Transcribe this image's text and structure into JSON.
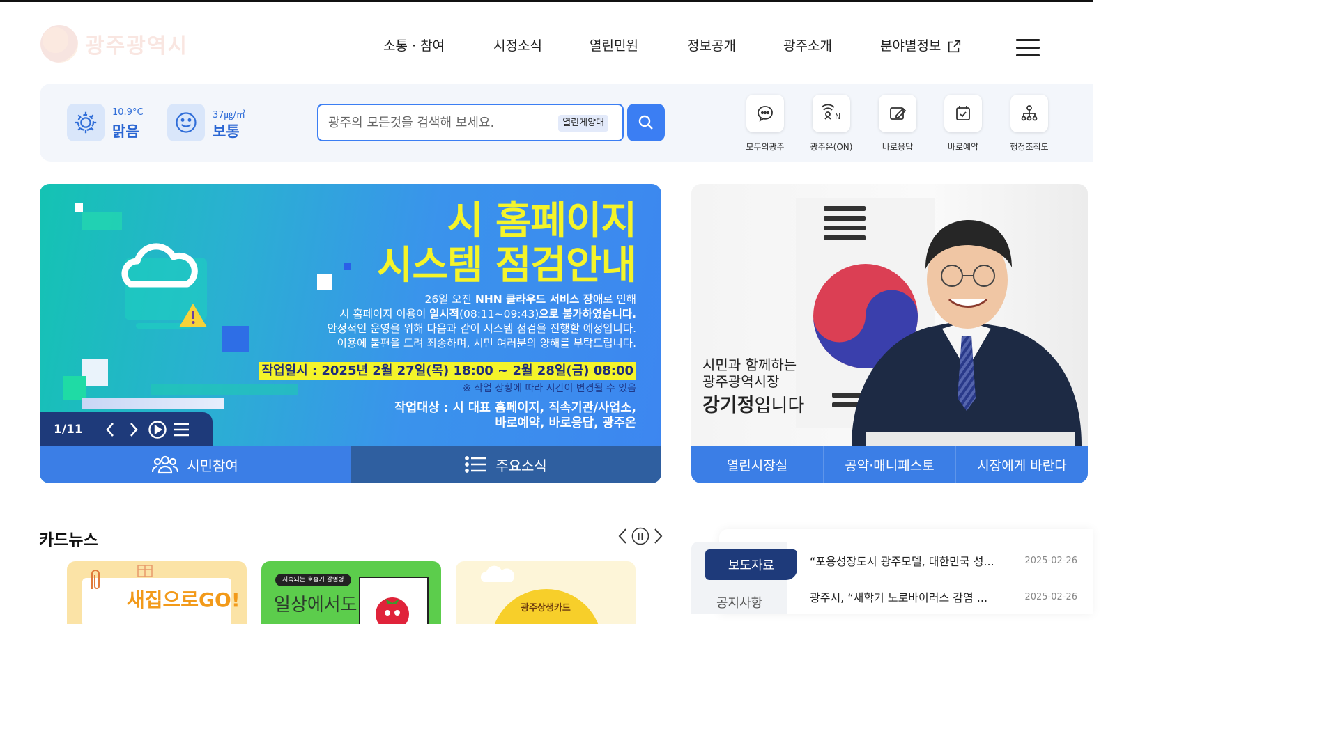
{
  "header": {
    "logo_text": "광주광역시",
    "nav": [
      {
        "label": "소통 · 참여"
      },
      {
        "label": "시정소식"
      },
      {
        "label": "열린민원"
      },
      {
        "label": "정보공개"
      },
      {
        "label": "광주소개"
      },
      {
        "label": "분야별정보",
        "external": true
      }
    ],
    "menu_icon": "hamburger-icon"
  },
  "utility": {
    "weather": {
      "temperature": "10.9°C",
      "condition": "맑음",
      "icon": "sun-icon"
    },
    "air": {
      "value": "37㎍/㎥",
      "status": "보통",
      "icon": "smile-icon"
    },
    "search": {
      "placeholder": "광주의 모든것을 검색해 보세요.",
      "tag": "열린게양대",
      "icon": "search-icon"
    },
    "quick_links": [
      {
        "label": "모두의광주",
        "icon": "chat-bubble-icon"
      },
      {
        "label": "광주온(ON)",
        "icon": "broadcast-on-icon"
      },
      {
        "label": "바로응답",
        "icon": "edit-note-icon"
      },
      {
        "label": "바로예약",
        "icon": "calendar-check-icon"
      },
      {
        "label": "행정조직도",
        "icon": "org-chart-icon"
      }
    ]
  },
  "banner": {
    "title_line1": "시 홈페이지",
    "title_line2": "시스템 점검안내",
    "lines": [
      {
        "pre": "26일 오전 ",
        "strong": "NHN 클라우드 서비스 장애",
        "post": "로 인해"
      },
      {
        "pre": "시 홈페이지 이용이 ",
        "strong": "일시적",
        "mid": "(08:11~09:43)",
        "strong2": "으로 불가하였습니다."
      },
      {
        "pre": "안정적인 운영을 위해 다음과 같이 시스템 점검을 진행할 예정입니다."
      },
      {
        "pre": "이용에 불편을 드려 죄송하며, 시민 여러분의 양해를 부탁드립니다."
      }
    ],
    "work_date": "작업일시 : 2025년 2월 27일(목) 18:00 ~ 2월 28일(금) 08:00",
    "note": "※ 작업 상황에 따라 시간이 변경될 수 있음",
    "target_line1": "작업대상 : 시 대표 홈페이지, 직속기관/사업소,",
    "target_line2": "바로예약, 바로응답, 광주온",
    "counter": "1/11",
    "tabs": [
      {
        "label": "시민참여",
        "icon": "people-icon"
      },
      {
        "label": "주요소식",
        "icon": "list-icon"
      }
    ]
  },
  "mayor": {
    "line1": "시민과 함께하는",
    "line2": "광주광역시장",
    "name": "강기정",
    "name_suffix": "입니다",
    "tabs": [
      "열린시장실",
      "공약·매니페스토",
      "시장에게 바란다"
    ]
  },
  "card_news": {
    "title": "카드뉴스",
    "cards": [
      {
        "caption": "새집으로GO!",
        "top_tag": ""
      },
      {
        "caption": "일상에서도",
        "top_tag": "지속되는 호흡기 감염병"
      },
      {
        "caption": "광주상생카드",
        "top_tag": ""
      }
    ]
  },
  "press": {
    "tabs": [
      "보도자료",
      "공지사항"
    ],
    "items": [
      {
        "title": "“포용성장도시 광주모델, 대한민국 성...",
        "date": "2025-02-26"
      },
      {
        "title": "광주시, “새학기 노로바이러스 감염 ...",
        "date": "2025-02-26"
      }
    ]
  },
  "colors": {
    "accent": "#3b7ef3",
    "navy": "#1e3a7a",
    "banner_title": "#f4f42a"
  }
}
